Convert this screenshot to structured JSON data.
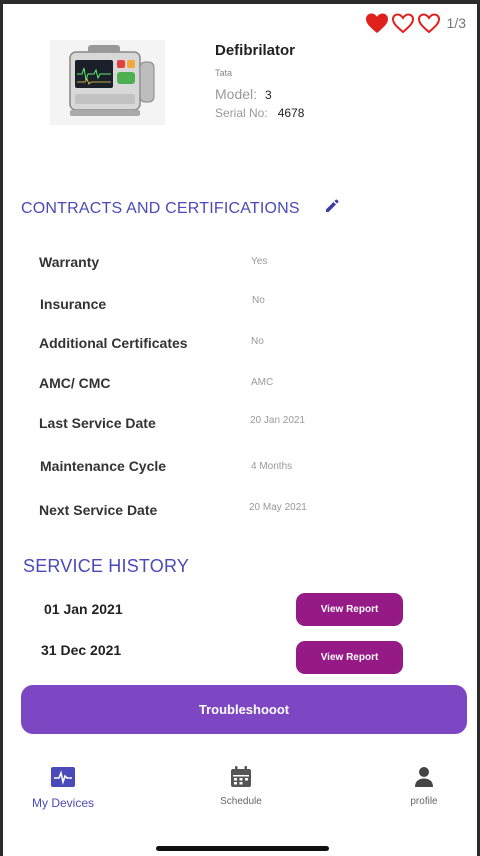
{
  "header": {
    "pager": "1/3",
    "favorite_color": "#e0201b"
  },
  "device": {
    "name": "Defibrilator",
    "brand": "Tata",
    "model_label": "Model:",
    "model_value": "3",
    "serial_label": "Serial No:",
    "serial_value": "4678"
  },
  "contracts": {
    "title": "CONTRACTS AND CERTIFICATIONS",
    "rows": [
      {
        "label": "Warranty",
        "value": "Yes"
      },
      {
        "label": "Insurance",
        "value": "No"
      },
      {
        "label": "Additional Certificates",
        "value": "No"
      },
      {
        "label": "AMC/ CMC",
        "value": "AMC"
      },
      {
        "label": "Last Service Date",
        "value": "20 Jan 2021"
      },
      {
        "label": "Maintenance Cycle",
        "value": "4 Months"
      },
      {
        "label": "Next Service Date",
        "value": "20 May 2021"
      }
    ]
  },
  "history": {
    "title": "SERVICE HISTORY",
    "entries": [
      {
        "date": "01 Jan 2021",
        "button": "View Report"
      },
      {
        "date": "31 Dec 2021",
        "button": "View Report"
      }
    ]
  },
  "actions": {
    "troubleshoot": "Troubleshooot"
  },
  "nav": {
    "devices": "My Devices",
    "schedule": "Schedule",
    "profile": "profile"
  },
  "colors": {
    "accent": "#4a4ab8",
    "report_button": "#951a86",
    "troubleshoot_button": "#7d47c4"
  }
}
